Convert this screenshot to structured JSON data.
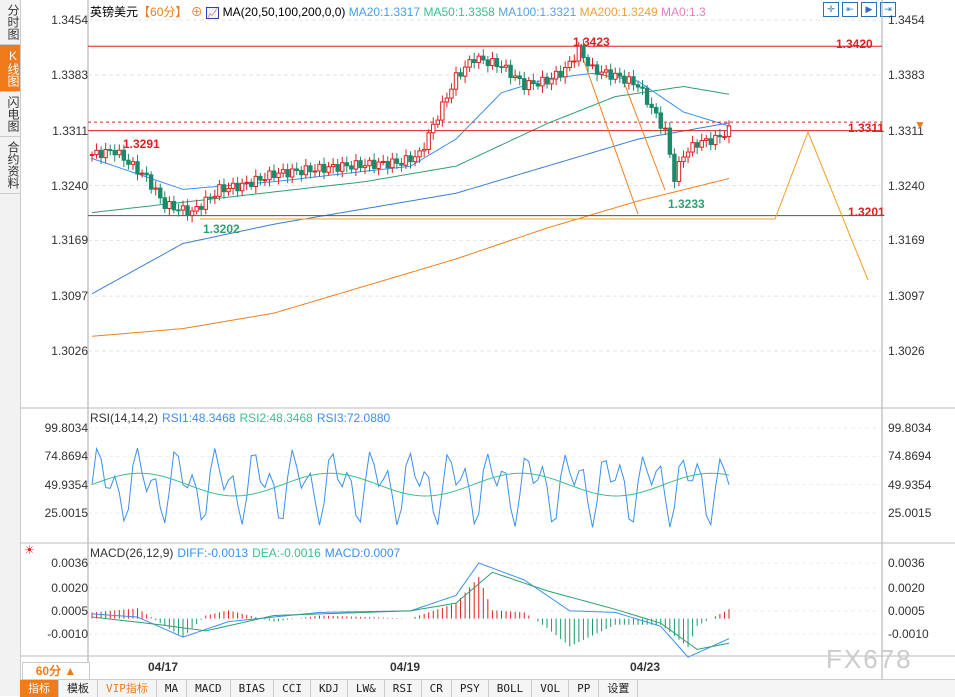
{
  "sidebar": {
    "tabs": [
      "分时图",
      "K线图",
      "闪电图",
      "合约资料"
    ],
    "active": 1
  },
  "header": {
    "symbol": "英镑美元",
    "period": "【60分】",
    "ma_label": "MA(20,50,100,200,0,0)",
    "ma20": "MA20:1.3317",
    "ma50": "MA50:1.3358",
    "ma100": "MA100:1.3321",
    "ma200": "MA200:1.3249",
    "ma0": "MA0:1.3"
  },
  "toolbar_icons": [
    "crosshair-icon",
    "zoom-left-icon",
    "zoom-chart-icon",
    "scroll-right-icon"
  ],
  "price_axis": [
    "1.3454",
    "1.3383",
    "1.3311",
    "1.3240",
    "1.3169",
    "1.3097",
    "1.3026"
  ],
  "annotations": {
    "high": "1.3423",
    "low": "1.3233",
    "l1": "1.3291",
    "l2": "1.3202",
    "r1": "1.3420",
    "r2": "1.3311",
    "r3": "1.3201"
  },
  "rsi": {
    "label": "RSI(14,14,2)",
    "rsi1": "RSI1:48.3468",
    "rsi2": "RSI2:48.3468",
    "rsi3": "RSI3:72.0880",
    "axis": [
      "99.8034",
      "74.8694",
      "49.9354",
      "25.0015"
    ]
  },
  "macd": {
    "label": "MACD(26,12,9)",
    "diff": "DIFF:-0.0013",
    "dea": "DEA:-0.0016",
    "macd": "MACD:0.0007",
    "axis": [
      "0.0036",
      "0.0020",
      "0.0005",
      "-0.0010"
    ]
  },
  "dates": [
    "04/17",
    "04/19",
    "04/23"
  ],
  "period_button": "60分 ▲",
  "bottom_tabs": [
    "指标",
    "模板",
    "VIP指标",
    "MA",
    "MACD",
    "BIAS",
    "CCI",
    "KDJ",
    "LW&",
    "RSI",
    "CR",
    "PSY",
    "BOLL",
    "VOL",
    "PP",
    "设置"
  ],
  "watermark": "FX678",
  "chart_data": {
    "type": "candlestick",
    "price_keypoints": [
      [
        0,
        1.328
      ],
      [
        5,
        1.3285
      ],
      [
        12,
        1.325
      ],
      [
        16,
        1.3215
      ],
      [
        22,
        1.3205
      ],
      [
        28,
        1.3235
      ],
      [
        33,
        1.324
      ],
      [
        40,
        1.3255
      ],
      [
        55,
        1.3265
      ],
      [
        68,
        1.327
      ],
      [
        72,
        1.328
      ],
      [
        76,
        1.333
      ],
      [
        80,
        1.338
      ],
      [
        84,
        1.3405
      ],
      [
        90,
        1.3395
      ],
      [
        95,
        1.337
      ],
      [
        100,
        1.3375
      ],
      [
        104,
        1.339
      ],
      [
        107,
        1.3415
      ],
      [
        110,
        1.339
      ],
      [
        116,
        1.338
      ],
      [
        120,
        1.337
      ],
      [
        123,
        1.334
      ],
      [
        126,
        1.331
      ],
      [
        128,
        1.325
      ],
      [
        130,
        1.328
      ],
      [
        133,
        1.3295
      ],
      [
        137,
        1.33
      ],
      [
        140,
        1.3311
      ]
    ],
    "ma20": [
      [
        0,
        1.3275
      ],
      [
        20,
        1.3235
      ],
      [
        40,
        1.3245
      ],
      [
        70,
        1.3265
      ],
      [
        80,
        1.33
      ],
      [
        90,
        1.336
      ],
      [
        100,
        1.3378
      ],
      [
        110,
        1.3385
      ],
      [
        120,
        1.3375
      ],
      [
        130,
        1.3335
      ],
      [
        140,
        1.3317
      ]
    ],
    "ma50": [
      [
        0,
        1.3205
      ],
      [
        30,
        1.3225
      ],
      [
        60,
        1.3245
      ],
      [
        80,
        1.3265
      ],
      [
        100,
        1.332
      ],
      [
        115,
        1.3355
      ],
      [
        130,
        1.3368
      ],
      [
        140,
        1.3358
      ]
    ],
    "ma100": [
      [
        0,
        1.31
      ],
      [
        20,
        1.3165
      ],
      [
        40,
        1.319
      ],
      [
        60,
        1.321
      ],
      [
        80,
        1.323
      ],
      [
        100,
        1.3265
      ],
      [
        120,
        1.33
      ],
      [
        140,
        1.3321
      ]
    ],
    "ma200": [
      [
        0,
        1.3045
      ],
      [
        20,
        1.3055
      ],
      [
        40,
        1.3075
      ],
      [
        60,
        1.311
      ],
      [
        80,
        1.3145
      ],
      [
        100,
        1.3185
      ],
      [
        120,
        1.322
      ],
      [
        140,
        1.3249
      ]
    ]
  }
}
